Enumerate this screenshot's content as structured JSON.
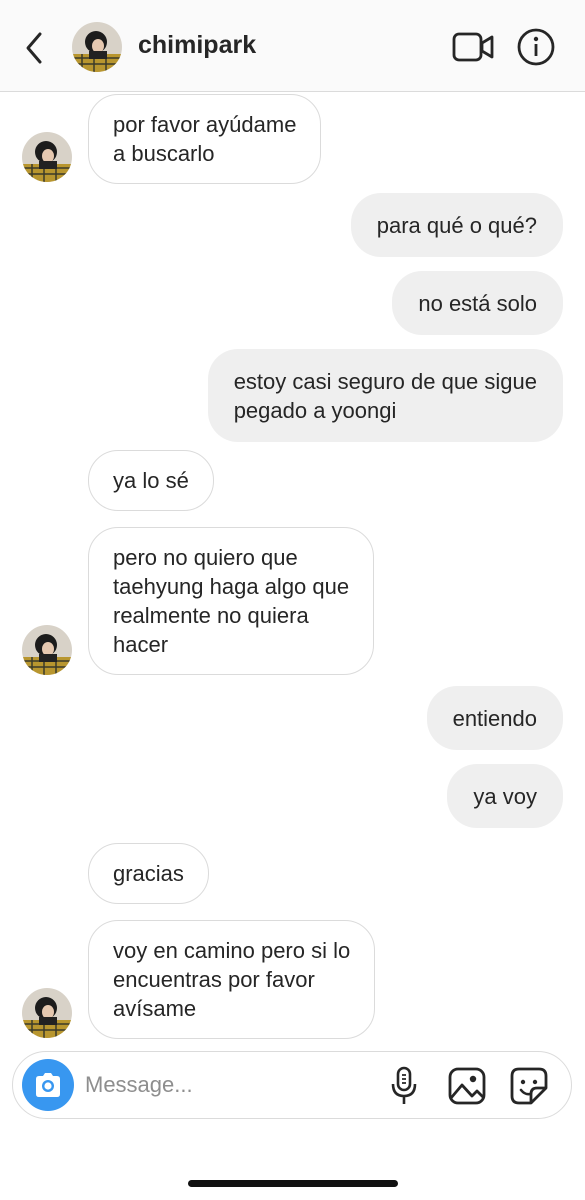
{
  "header": {
    "username": "chimipark",
    "back_icon": "chevron-left-icon",
    "video_icon": "video-camera-icon",
    "info_icon": "info-icon"
  },
  "messages": [
    {
      "side": "in",
      "text": "por favor ayúdame\na buscarlo"
    },
    {
      "side": "out",
      "text": "para qué o qué?"
    },
    {
      "side": "out",
      "text": "no está solo"
    },
    {
      "side": "out",
      "text": "estoy casi seguro de que sigue\npegado a yoongi"
    },
    {
      "side": "in",
      "text": "ya lo sé"
    },
    {
      "side": "in",
      "text": "pero no quiero que\ntaehyung haga algo que\nrealmente no quiera\nhacer"
    },
    {
      "side": "out",
      "text": "entiendo"
    },
    {
      "side": "out",
      "text": "ya voy"
    },
    {
      "side": "in",
      "text": "gracias"
    },
    {
      "side": "in",
      "text": "voy en camino pero si lo\nencuentras por favor\navísame"
    }
  ],
  "composer": {
    "placeholder": "Message...",
    "camera_icon": "camera-icon",
    "mic_icon": "microphone-icon",
    "gallery_icon": "image-icon",
    "sticker_icon": "sticker-icon"
  },
  "colors": {
    "incoming_bubble_border": "#dbdbdb",
    "outgoing_bubble_bg": "#efefef",
    "camera_button": "#3897f0"
  }
}
